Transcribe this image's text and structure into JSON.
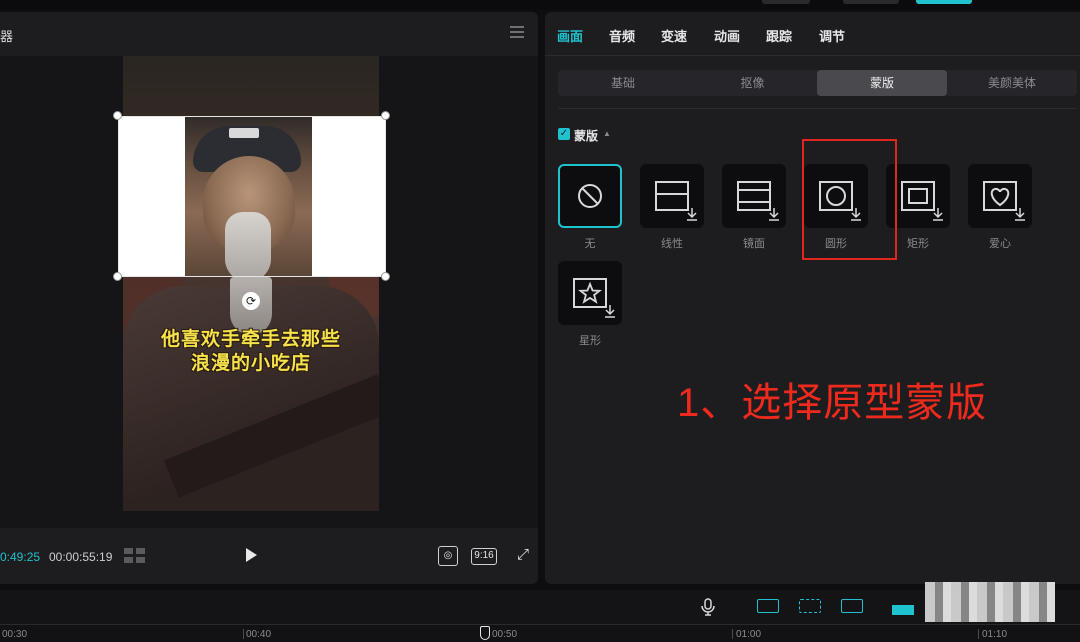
{
  "player": {
    "title": "器",
    "time_current": "0:49:25",
    "time_total": "00:00:55:19",
    "ratio": "9:16",
    "caption_line1": "他喜欢手牵手去那些",
    "caption_line2": "浪漫的小吃店"
  },
  "inspector": {
    "main_tabs": [
      "画面",
      "音频",
      "变速",
      "动画",
      "跟踪",
      "调节"
    ],
    "active_main_tab": "画面",
    "sub_tabs": [
      "基础",
      "抠像",
      "蒙版",
      "美颜美体"
    ],
    "active_sub_tab": "蒙版",
    "mask_section_label": "蒙版",
    "mask_enabled": true,
    "masks": [
      {
        "label": "无",
        "icon": "none-icon",
        "selected": true,
        "downloadable": false
      },
      {
        "label": "线性",
        "icon": "linear-mask-icon",
        "selected": false,
        "downloadable": true
      },
      {
        "label": "镜面",
        "icon": "mirror-mask-icon",
        "selected": false,
        "downloadable": true
      },
      {
        "label": "圆形",
        "icon": "circle-mask-icon",
        "selected": false,
        "downloadable": true
      },
      {
        "label": "矩形",
        "icon": "rectangle-mask-icon",
        "selected": false,
        "downloadable": true
      },
      {
        "label": "爱心",
        "icon": "heart-mask-icon",
        "selected": false,
        "downloadable": true
      },
      {
        "label": "星形",
        "icon": "star-mask-icon",
        "selected": false,
        "downloadable": true
      }
    ],
    "annotation": "1、选择原型蒙版",
    "highlight_color": "#e0261d"
  },
  "timeline": {
    "ticks": [
      "00:30",
      "00:40",
      "00:50",
      "01:00",
      "01:10"
    ]
  },
  "colors": {
    "accent": "#1fc2cf",
    "panel_bg": "#1d1d20",
    "annotation_red": "#ef2a1c"
  }
}
